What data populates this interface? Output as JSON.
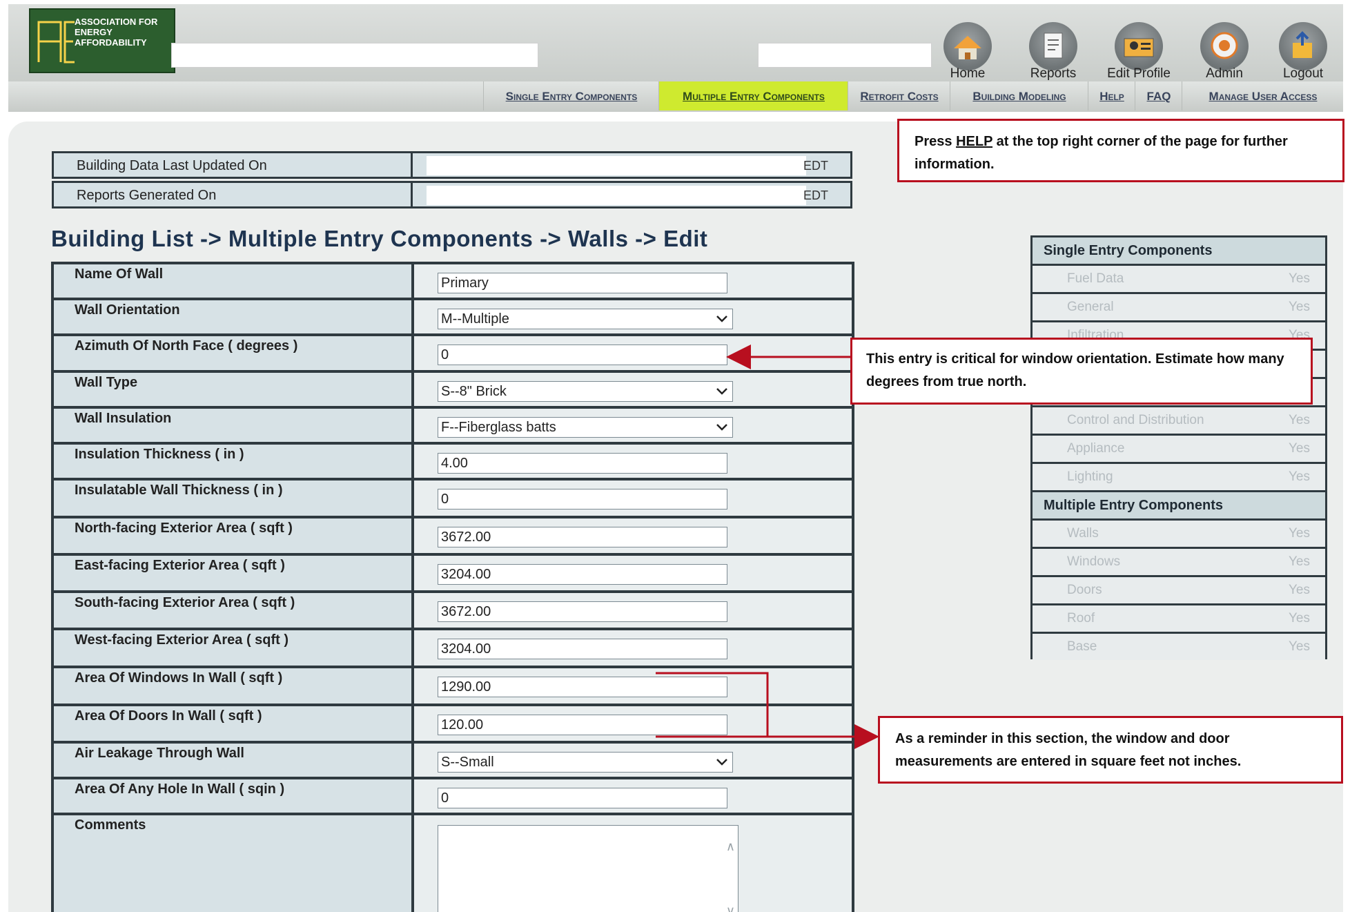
{
  "header": {
    "logo_text": "ASSOCIATION FOR ENERGY AFFORDABILITY",
    "nav": [
      "Home",
      "Reports",
      "Edit Profile",
      "Admin",
      "Logout"
    ]
  },
  "subnav": [
    "Single Entry Components",
    "Multiple Entry Components",
    "Retrofit Costs",
    "Building Modeling",
    "Help",
    "FAQ",
    "Manage User Access"
  ],
  "info": {
    "updated_label": "Building Data Last Updated On",
    "updated_suffix": "EDT",
    "reports_label": "Reports Generated On",
    "reports_suffix": "EDT"
  },
  "page_title": "Building List -> Multiple Entry Components -> Walls -> Edit",
  "form": {
    "rows": [
      {
        "label": "Name Of Wall",
        "value": "Primary",
        "type": "text"
      },
      {
        "label": "Wall Orientation",
        "value": "M--Multiple",
        "type": "select"
      },
      {
        "label": "Azimuth Of North Face ( degrees )",
        "value": "0",
        "type": "text"
      },
      {
        "label": "Wall Type",
        "value": "S--8\" Brick",
        "type": "select"
      },
      {
        "label": "Wall Insulation",
        "value": "F--Fiberglass batts",
        "type": "select"
      },
      {
        "label": "Insulation Thickness ( in )",
        "value": "4.00",
        "type": "text"
      },
      {
        "label": "Insulatable Wall Thickness ( in )",
        "value": "0",
        "type": "text"
      },
      {
        "label": "North-facing Exterior Area ( sqft )",
        "value": "3672.00",
        "type": "text"
      },
      {
        "label": "East-facing Exterior Area ( sqft )",
        "value": "3204.00",
        "type": "text"
      },
      {
        "label": "South-facing Exterior Area ( sqft )",
        "value": "3672.00",
        "type": "text"
      },
      {
        "label": "West-facing Exterior Area ( sqft )",
        "value": "3204.00",
        "type": "text"
      },
      {
        "label": "Area Of Windows In Wall ( sqft )",
        "value": "1290.00",
        "type": "text"
      },
      {
        "label": "Area Of Doors In Wall ( sqft )",
        "value": "120.00",
        "type": "text"
      },
      {
        "label": "Air Leakage Through Wall",
        "value": "S--Small",
        "type": "select"
      },
      {
        "label": "Area Of Any Hole In Wall ( sqin )",
        "value": "0",
        "type": "text"
      },
      {
        "label": "Comments",
        "value": "",
        "type": "textarea"
      }
    ]
  },
  "sidebar": {
    "single_title": "Single Entry Components",
    "single_items": [
      {
        "name": "Fuel Data",
        "status": "Yes"
      },
      {
        "name": "General",
        "status": "Yes"
      },
      {
        "name": "Infiltration",
        "status": "Yes"
      },
      {
        "name": "",
        "status": ""
      },
      {
        "name": "",
        "status": ""
      },
      {
        "name": "Control and Distribution",
        "status": "Yes"
      },
      {
        "name": "Appliance",
        "status": "Yes"
      },
      {
        "name": "Lighting",
        "status": "Yes"
      }
    ],
    "multiple_title": "Multiple Entry Components",
    "multiple_items": [
      {
        "name": "Walls",
        "status": "Yes"
      },
      {
        "name": "Windows",
        "status": "Yes"
      },
      {
        "name": "Doors",
        "status": "Yes"
      },
      {
        "name": "Roof",
        "status": "Yes"
      },
      {
        "name": "Base",
        "status": "Yes"
      }
    ]
  },
  "callouts": {
    "help_pre": "Press ",
    "help_link": "HELP",
    "help_post": " at the top right corner of the page for further information.",
    "azimuth": "This entry is critical for window orientation.  Estimate how many degrees from true north.",
    "sqft": "As a reminder in this section, the window and door measurements are entered in square feet not inches."
  },
  "colors": {
    "accent_active": "#cfea2f",
    "callout_border": "#b80f1f",
    "logo_green": "#2c5e2e",
    "table_border": "#2f3a40"
  }
}
